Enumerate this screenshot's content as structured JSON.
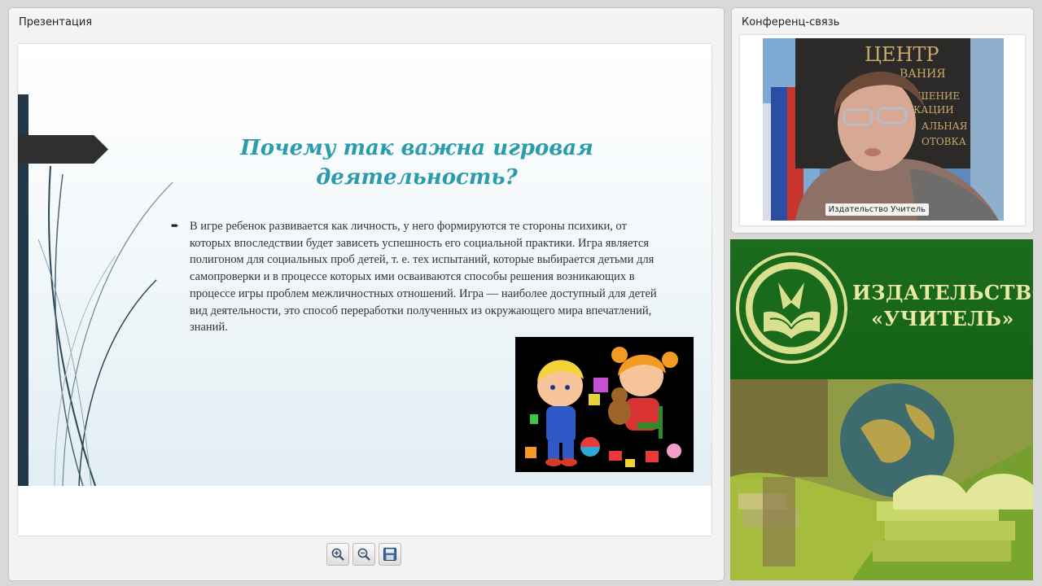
{
  "presentation": {
    "title": "Презентация",
    "slide": {
      "heading": "Почему так важна игровая деятельность?",
      "bullet_symbol": "➨",
      "body": "В игре ребенок развивается как личность, у него формируются те стороны психики, от которых впоследствии будет зависеть успешность его социальной практики. Игра является полигоном для социальных проб детей, т. е. тех испытаний, которые выбирается детьми для самопроверки и в процессе которых ими осваиваются способы решения возникающих в процессе игры проблем межличностных отношений. Игра — наиболее доступный для детей вид деятельности, это способ переработки полученных из окружающего мира впечатлений, знаний."
    },
    "toolbar": {
      "zoom_in_icon": "zoom-in-icon",
      "zoom_out_icon": "zoom-out-icon",
      "save_icon": "save-icon"
    }
  },
  "conference": {
    "title": "Конференц-связь",
    "participant_name": "Издательство Учитель"
  },
  "publisher": {
    "brand_line1": "ИЗДАТЕЛЬСТВО",
    "brand_line2": "«УЧИТЕЛЬ»"
  },
  "colors": {
    "slide_heading": "#2a9cab",
    "banner_green": "#1c6b1f",
    "banner_text": "#e7e9a5"
  }
}
